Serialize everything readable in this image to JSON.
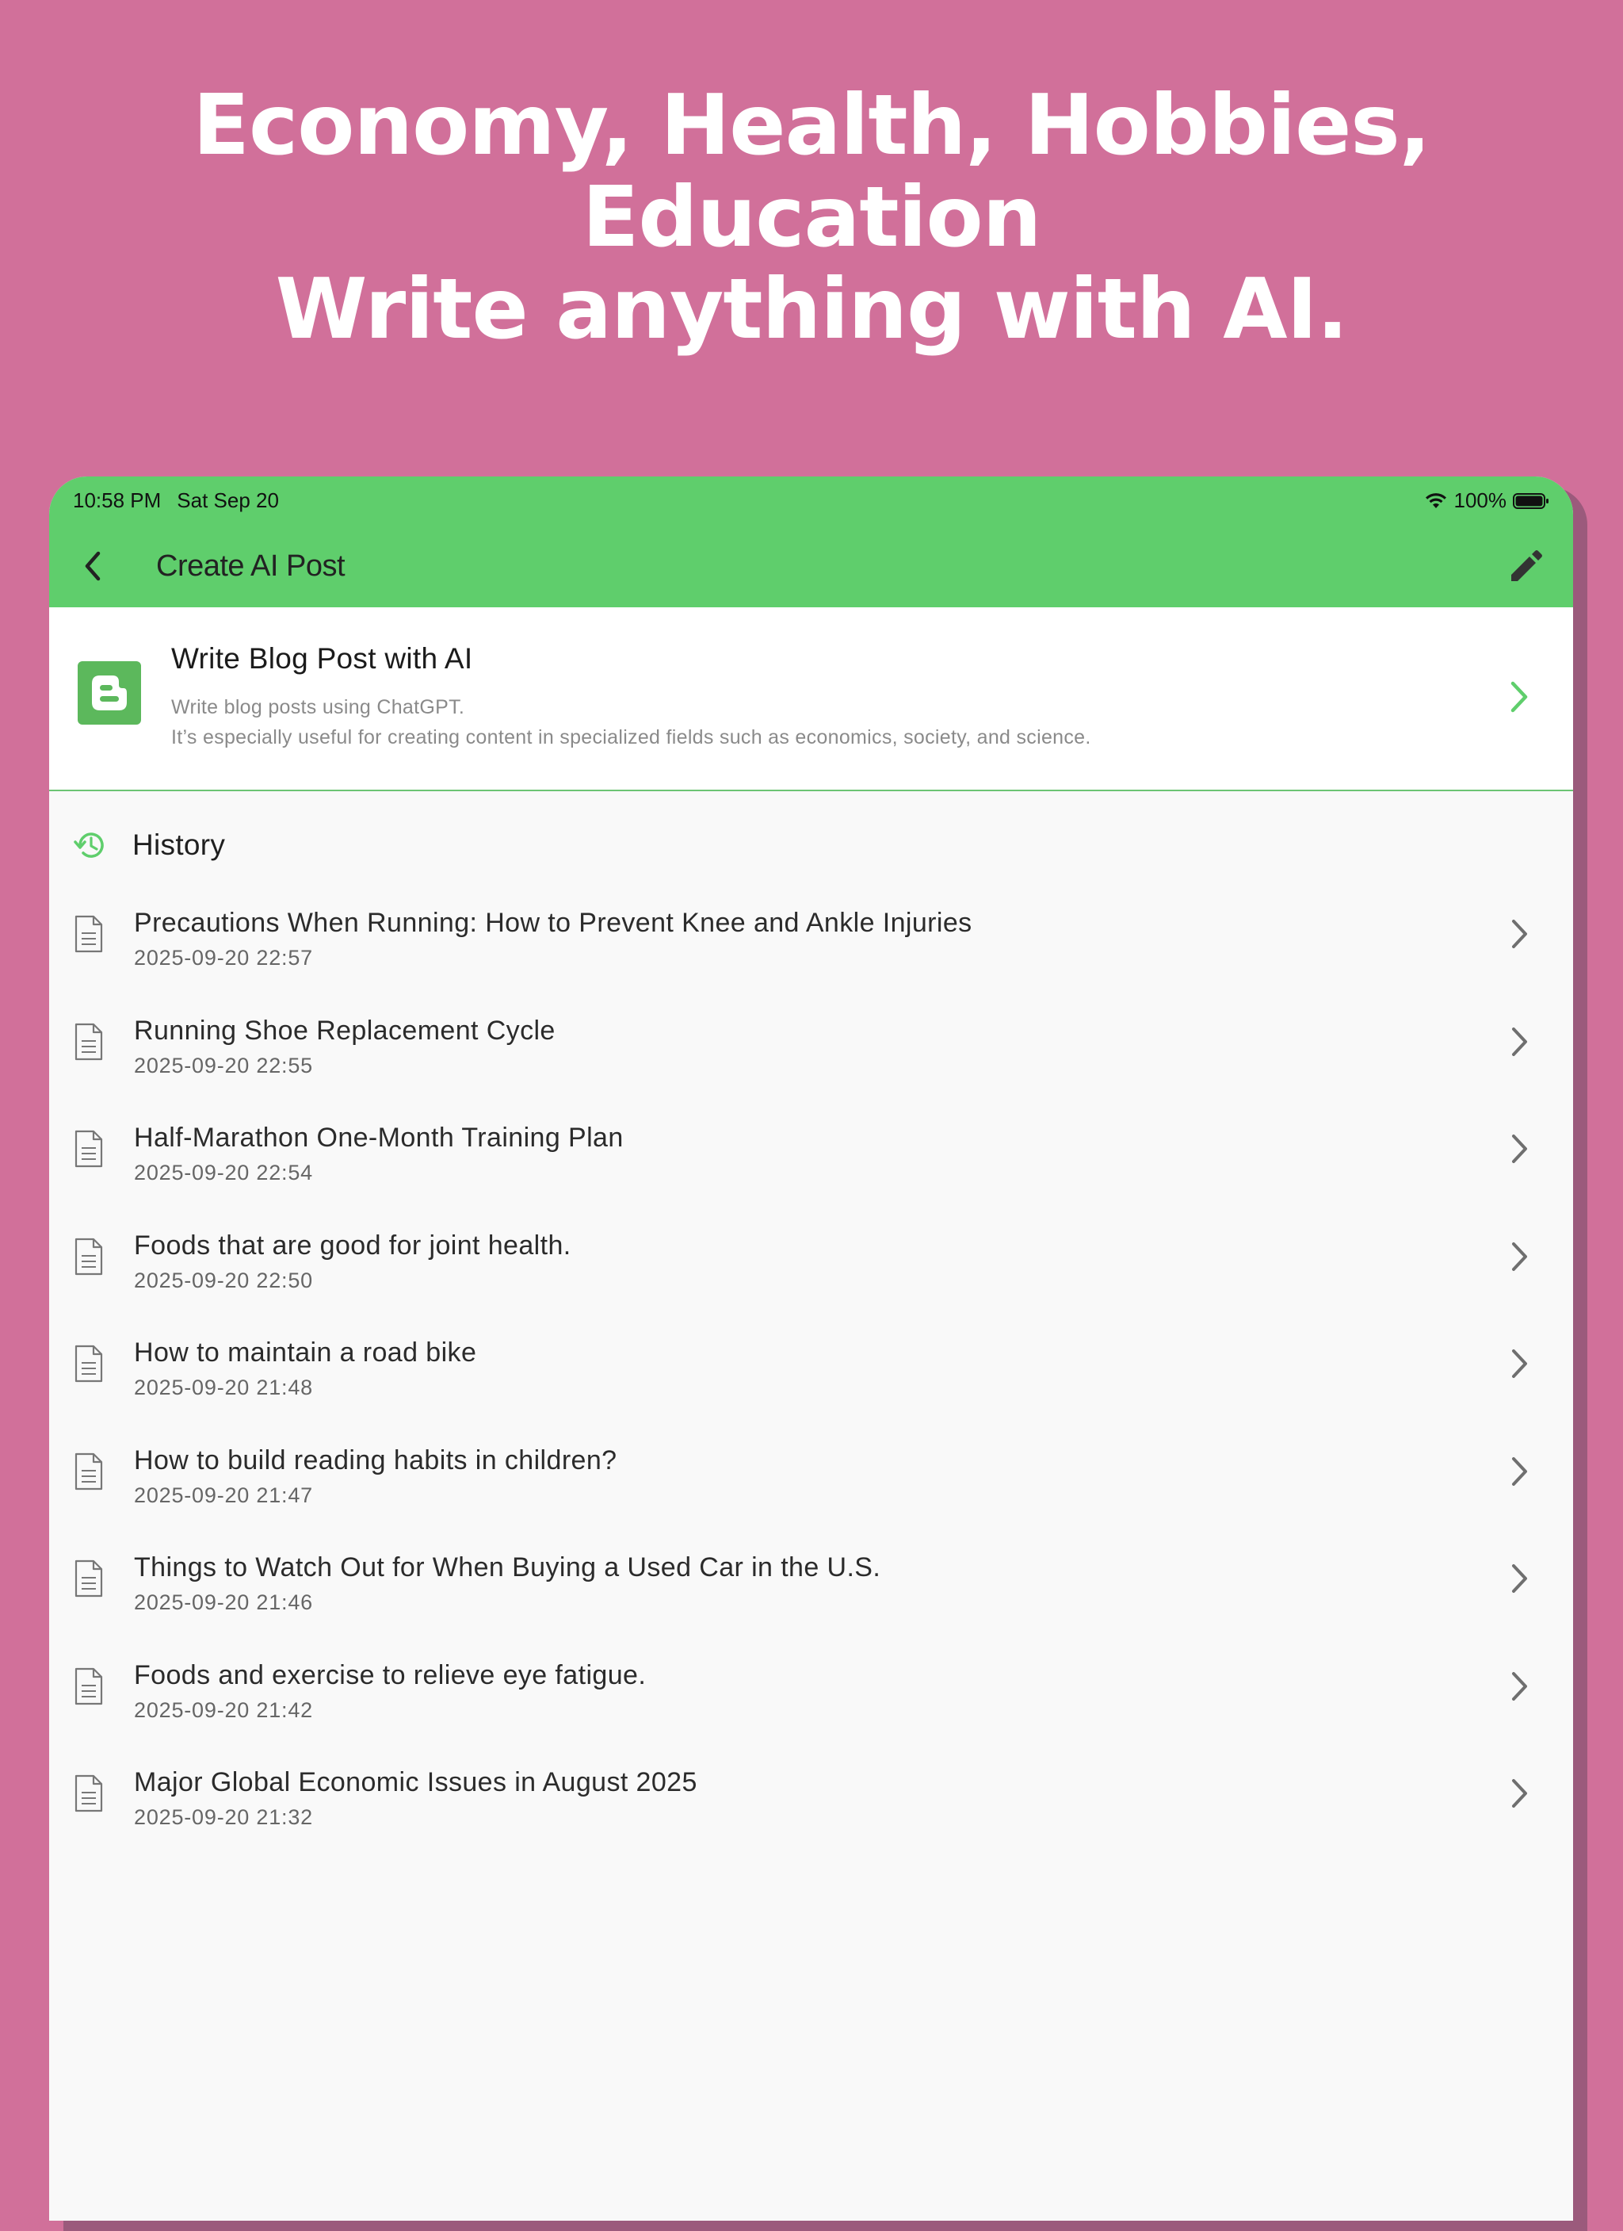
{
  "headline": {
    "line1": "Economy, Health, Hobbies,",
    "line2": "Education",
    "line3": "Write anything with AI."
  },
  "status_bar": {
    "time": "10:58 PM",
    "date": "Sat Sep 20",
    "battery": "100%"
  },
  "nav": {
    "title": "Create AI Post",
    "back_icon": "chevron-left-icon",
    "edit_icon": "pencil-icon"
  },
  "promo": {
    "title": "Write Blog Post with AI",
    "desc_line1": "Write blog posts using ChatGPT.",
    "desc_line2": "It’s especially useful for creating content in specialized fields such as economics, society, and science.",
    "accent_color": "#5fce6c"
  },
  "history": {
    "label": "History",
    "items": [
      {
        "title": "Precautions When Running: How to Prevent Knee and Ankle Injuries",
        "date": "2025-09-20 22:57"
      },
      {
        "title": "Running Shoe Replacement Cycle",
        "date": "2025-09-20 22:55"
      },
      {
        "title": "Half-Marathon One-Month Training Plan",
        "date": "2025-09-20 22:54"
      },
      {
        "title": "Foods that are good for joint health.",
        "date": "2025-09-20 22:50"
      },
      {
        "title": "How to maintain a road bike",
        "date": "2025-09-20 21:48"
      },
      {
        "title": "How to build reading habits in children?",
        "date": "2025-09-20 21:47"
      },
      {
        "title": "Things to Watch Out for When Buying a Used Car in the U.S.",
        "date": "2025-09-20 21:46"
      },
      {
        "title": "Foods and exercise to relieve eye fatigue.",
        "date": "2025-09-20 21:42"
      },
      {
        "title": "Major Global Economic Issues in August 2025",
        "date": "2025-09-20 21:32"
      }
    ]
  },
  "colors": {
    "background": "#d1709a",
    "header_green": "#5fce6c",
    "list_background": "#f9f9f9"
  }
}
